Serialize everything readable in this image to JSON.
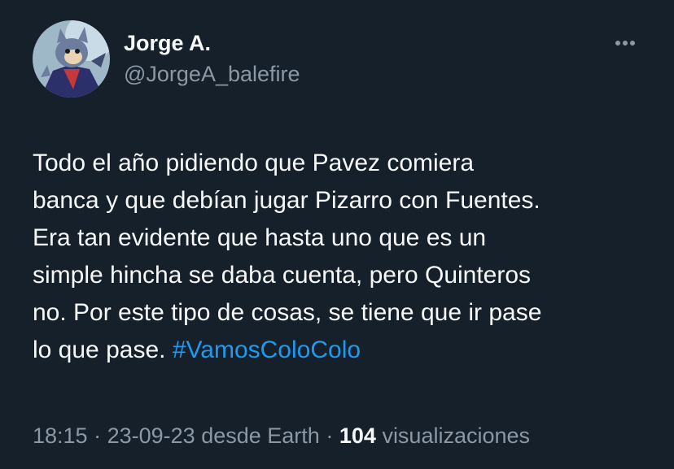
{
  "author": {
    "display_name": "Jorge A.",
    "handle": "@JorgeA_balefire"
  },
  "tweet": {
    "text_lines": [
      "Todo el año pidiendo que Pavez comiera",
      "banca y que debían jugar Pizarro con Fuentes.",
      "Era tan evidente que hasta uno que es un",
      "simple hincha se daba cuenta, pero Quinteros",
      "no. Por este tipo de cosas, se tiene que ir pase"
    ],
    "last_line_text": "lo que pase.",
    "hashtag": "#VamosColoColo"
  },
  "meta": {
    "time": "18:15",
    "separator": "·",
    "date": "23-09-23",
    "source": "desde Earth",
    "views_count": "104",
    "views_label": "visualizaciones"
  },
  "icons": {
    "more": "more-horizontal-icon"
  },
  "colors": {
    "background": "#15202b",
    "primary_text": "#f7f9f9",
    "secondary_text": "#8b98a5",
    "accent": "#1d9bf0"
  }
}
